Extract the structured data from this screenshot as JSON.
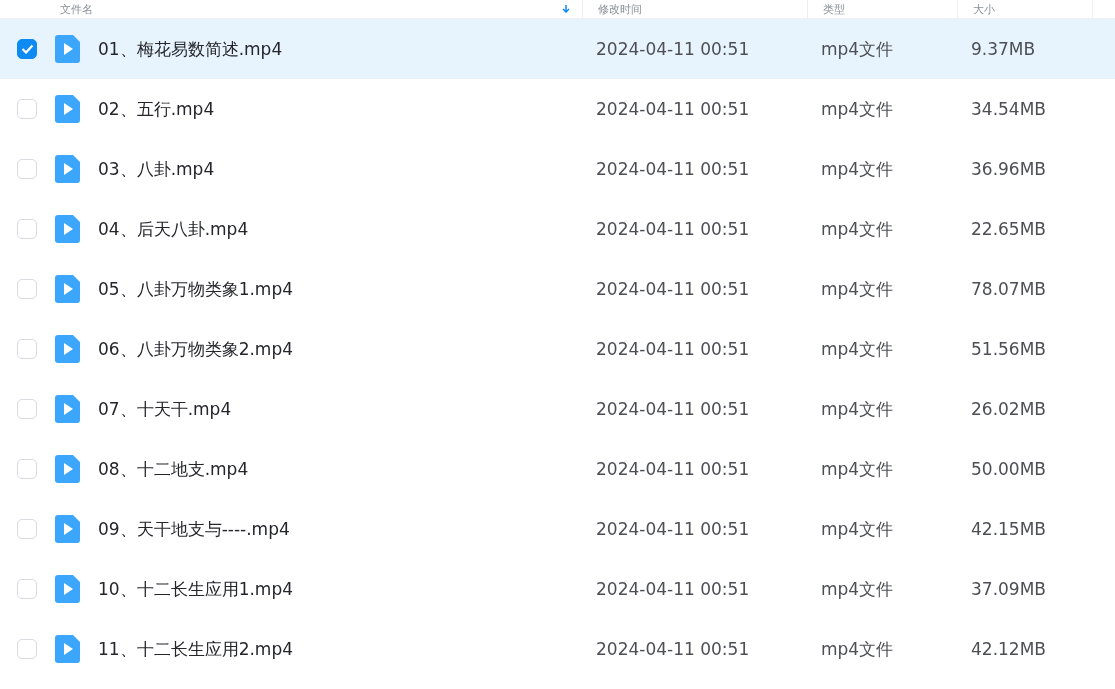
{
  "table": {
    "columns": [
      {
        "label": "文件名",
        "sorted": true
      },
      {
        "label": "修改时间",
        "sorted": false
      },
      {
        "label": "类型",
        "sorted": false
      },
      {
        "label": "大小",
        "sorted": false
      }
    ],
    "rows": [
      {
        "name": "01、梅花易数简述.mp4",
        "modified": "2024-04-11 00:51",
        "type": "mp4文件",
        "size": "9.37MB",
        "selected": true
      },
      {
        "name": "02、五行.mp4",
        "modified": "2024-04-11 00:51",
        "type": "mp4文件",
        "size": "34.54MB",
        "selected": false
      },
      {
        "name": "03、八卦.mp4",
        "modified": "2024-04-11 00:51",
        "type": "mp4文件",
        "size": "36.96MB",
        "selected": false
      },
      {
        "name": "04、后天八卦.mp4",
        "modified": "2024-04-11 00:51",
        "type": "mp4文件",
        "size": "22.65MB",
        "selected": false
      },
      {
        "name": "05、八卦万物类象1.mp4",
        "modified": "2024-04-11 00:51",
        "type": "mp4文件",
        "size": "78.07MB",
        "selected": false
      },
      {
        "name": "06、八卦万物类象2.mp4",
        "modified": "2024-04-11 00:51",
        "type": "mp4文件",
        "size": "51.56MB",
        "selected": false
      },
      {
        "name": "07、十天干.mp4",
        "modified": "2024-04-11 00:51",
        "type": "mp4文件",
        "size": "26.02MB",
        "selected": false
      },
      {
        "name": "08、十二地支.mp4",
        "modified": "2024-04-11 00:51",
        "type": "mp4文件",
        "size": "50.00MB",
        "selected": false
      },
      {
        "name": "09、天干地支与----.mp4",
        "modified": "2024-04-11 00:51",
        "type": "mp4文件",
        "size": "42.15MB",
        "selected": false
      },
      {
        "name": "10、十二长生应用1.mp4",
        "modified": "2024-04-11 00:51",
        "type": "mp4文件",
        "size": "37.09MB",
        "selected": false
      },
      {
        "name": "11、十二长生应用2.mp4",
        "modified": "2024-04-11 00:51",
        "type": "mp4文件",
        "size": "42.12MB",
        "selected": false
      }
    ]
  }
}
